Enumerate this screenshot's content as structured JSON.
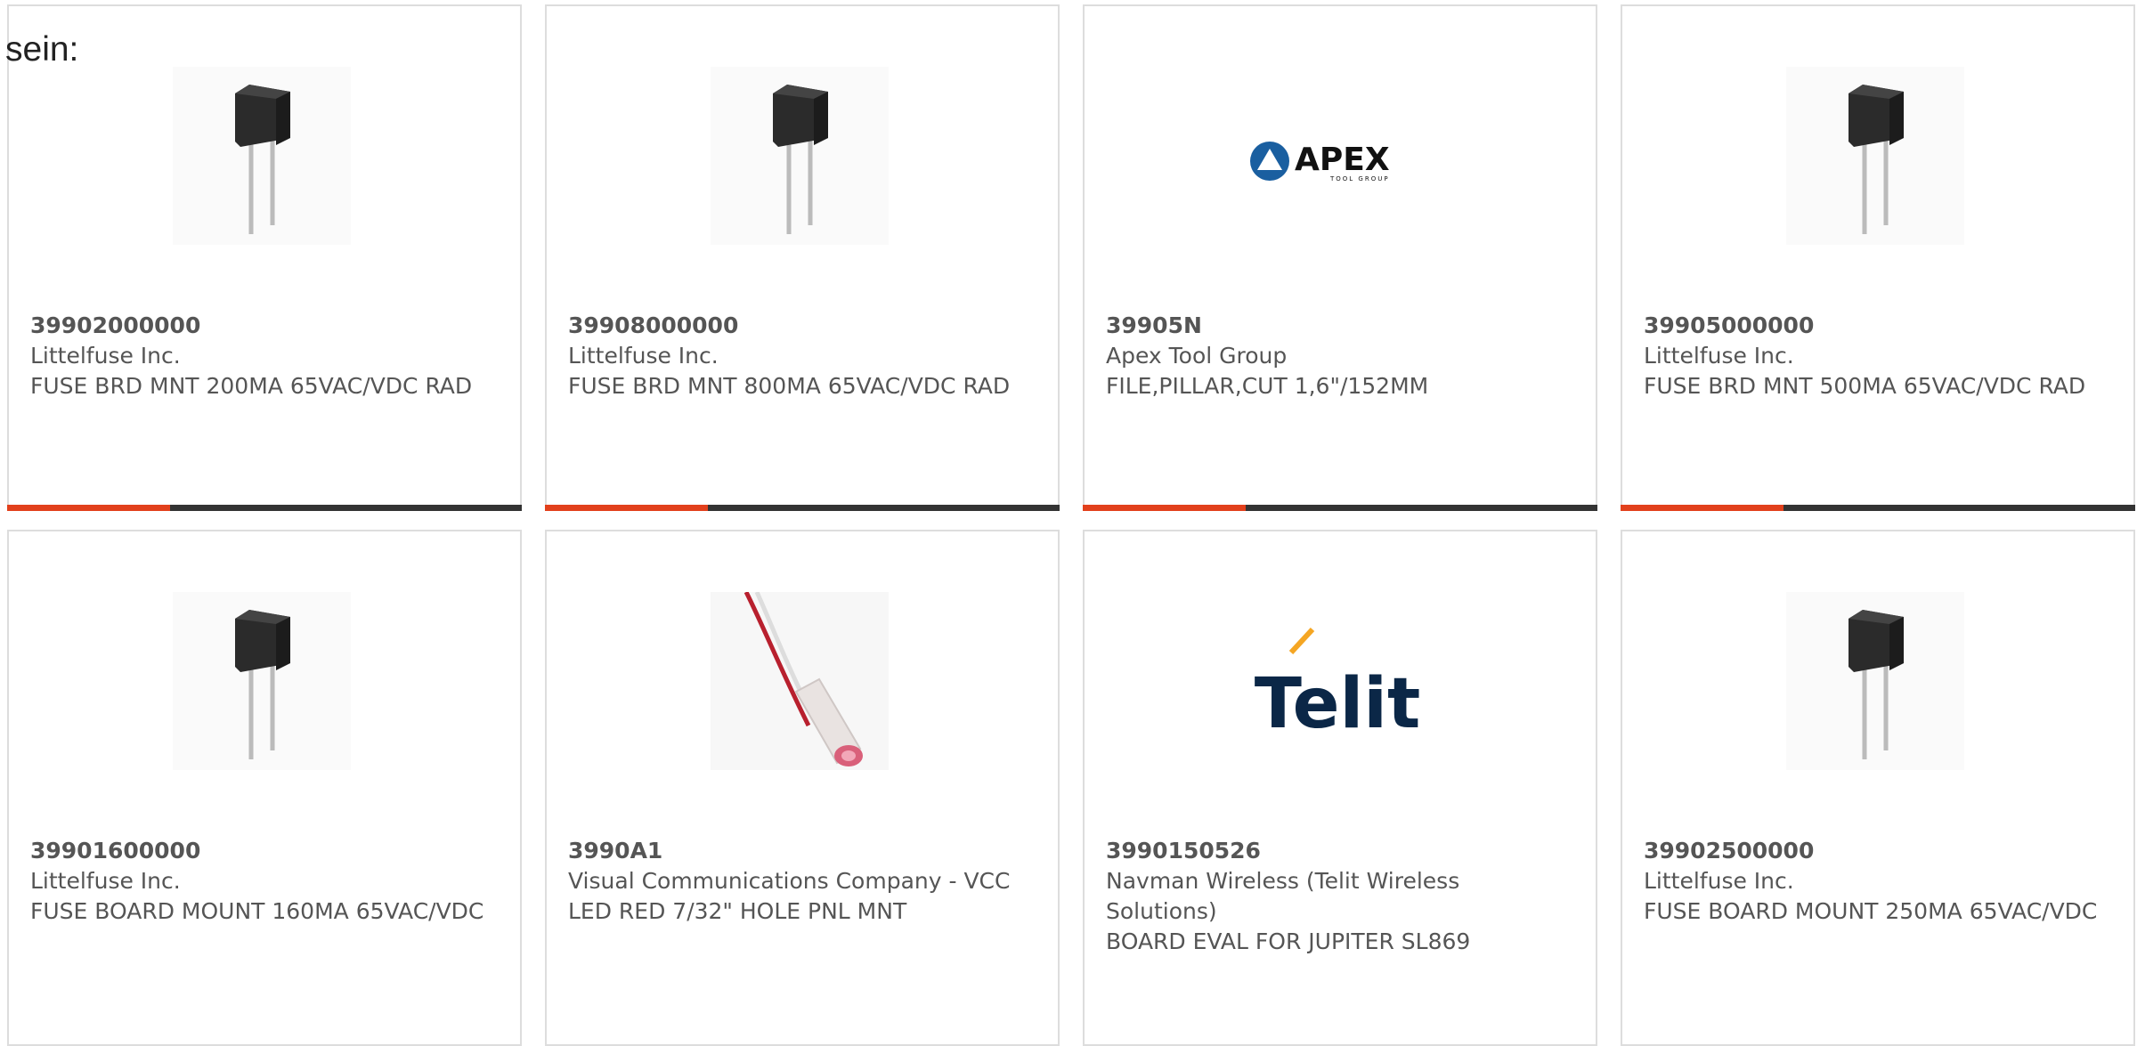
{
  "page": {
    "label": "sein:"
  },
  "colors": {
    "accent": "#e2401c",
    "bar_dark": "#333333",
    "text": "#555555",
    "border": "#dddddd",
    "apex_blue": "#1a5fa0",
    "telit_navy": "#0b2747",
    "telit_orange": "#f5a623"
  },
  "products": [
    {
      "part_number": "39902000000",
      "manufacturer": "Littelfuse Inc.",
      "description": "FUSE BRD MNT 200MA 65VAC/VDC RAD",
      "image": "radial-fuse-image"
    },
    {
      "part_number": "39908000000",
      "manufacturer": "Littelfuse Inc.",
      "description": "FUSE BRD MNT 800MA 65VAC/VDC RAD",
      "image": "radial-fuse-image"
    },
    {
      "part_number": "39905N",
      "manufacturer": "Apex Tool Group",
      "description": "FILE,PILLAR,CUT 1,6\"/152MM",
      "image": "apex-logo",
      "logo_text": "APEX",
      "logo_subtext": "TOOL GROUP"
    },
    {
      "part_number": "39905000000",
      "manufacturer": "Littelfuse Inc.",
      "description": "FUSE BRD MNT 500MA 65VAC/VDC RAD",
      "image": "radial-fuse-image"
    },
    {
      "part_number": "39901600000",
      "manufacturer": "Littelfuse Inc.",
      "description": "FUSE BOARD MOUNT 160MA 65VAC/VDC",
      "image": "radial-fuse-image"
    },
    {
      "part_number": "3990A1",
      "manufacturer": "Visual Communications Company - VCC",
      "description": "LED RED 7/32\" HOLE PNL MNT",
      "image": "panel-led-image"
    },
    {
      "part_number": "3990150526",
      "manufacturer": "Navman Wireless (Telit Wireless Solutions)",
      "description": "BOARD EVAL FOR JUPITER SL869",
      "image": "telit-logo",
      "logo_text": "Telit"
    },
    {
      "part_number": "39902500000",
      "manufacturer": "Littelfuse Inc.",
      "description": "FUSE BOARD MOUNT 250MA 65VAC/VDC",
      "image": "radial-fuse-image"
    }
  ]
}
